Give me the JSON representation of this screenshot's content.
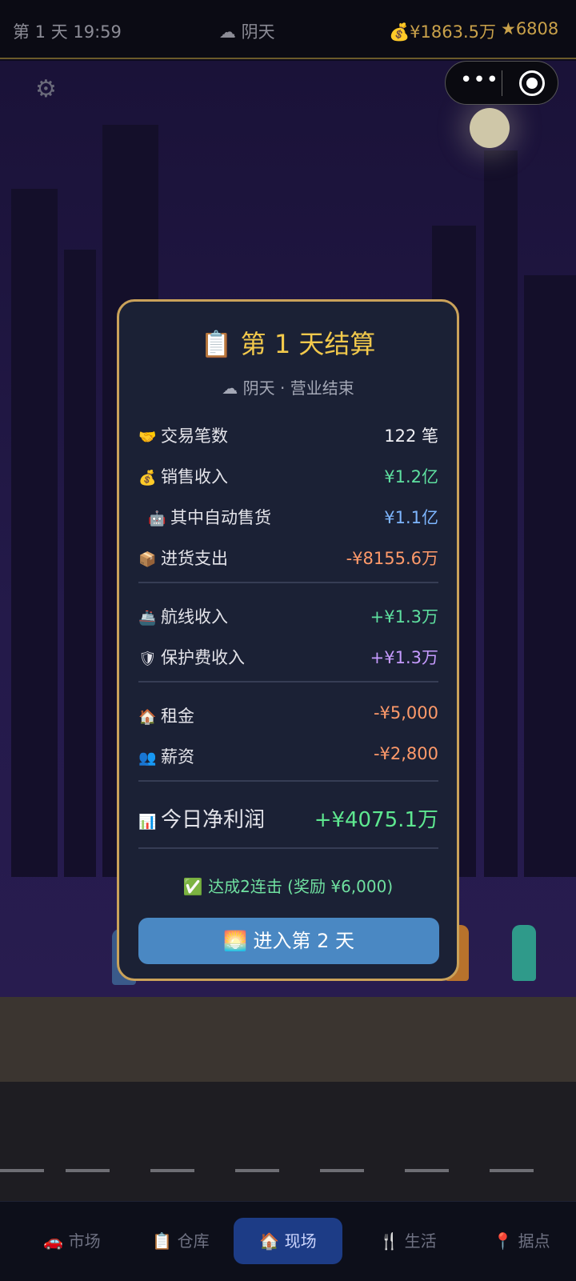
{
  "status": {
    "day_time": "第 1 天 19:59",
    "weather": "☁ 阴天",
    "money": "💰¥1863.5万",
    "stars": "★6808"
  },
  "icons": {
    "settings": "⚙",
    "more": "•••"
  },
  "summary": {
    "title": "📋 第 1 天结算",
    "subtitle": "☁ 阴天 · 营业结束",
    "rows": [
      {
        "icon": "🤝",
        "label": "交易笔数",
        "value": "122 笔"
      },
      {
        "icon": "💰",
        "label": "销售收入",
        "value": "¥1.2亿"
      },
      {
        "icon": "🤖",
        "label": "其中自动售货",
        "value": "¥1.1亿"
      },
      {
        "icon": "📦",
        "label": "进货支出",
        "value": "-¥8155.6万"
      },
      {
        "icon": "🚢",
        "label": "航线收入",
        "value": "+¥1.3万"
      },
      {
        "icon": "🛡",
        "label": "保护费收入",
        "value": "+¥1.3万"
      },
      {
        "icon": "🏠",
        "label": "租金",
        "value": "-¥5,000"
      },
      {
        "icon": "👥",
        "label": "薪资",
        "value": "-¥2,800"
      }
    ],
    "profit": {
      "icon": "📊",
      "label": "今日净利润",
      "value": "+¥4075.1万"
    },
    "combo": "✅ 达成2连击 (奖励 ¥6,000)",
    "next_button": "🌅 进入第 2 天"
  },
  "nav": [
    {
      "label": "🚗 市场"
    },
    {
      "label": "📋 仓库"
    },
    {
      "label": "🏠 现场"
    },
    {
      "label": "🍴 生活"
    },
    {
      "label": "📍 据点"
    }
  ]
}
